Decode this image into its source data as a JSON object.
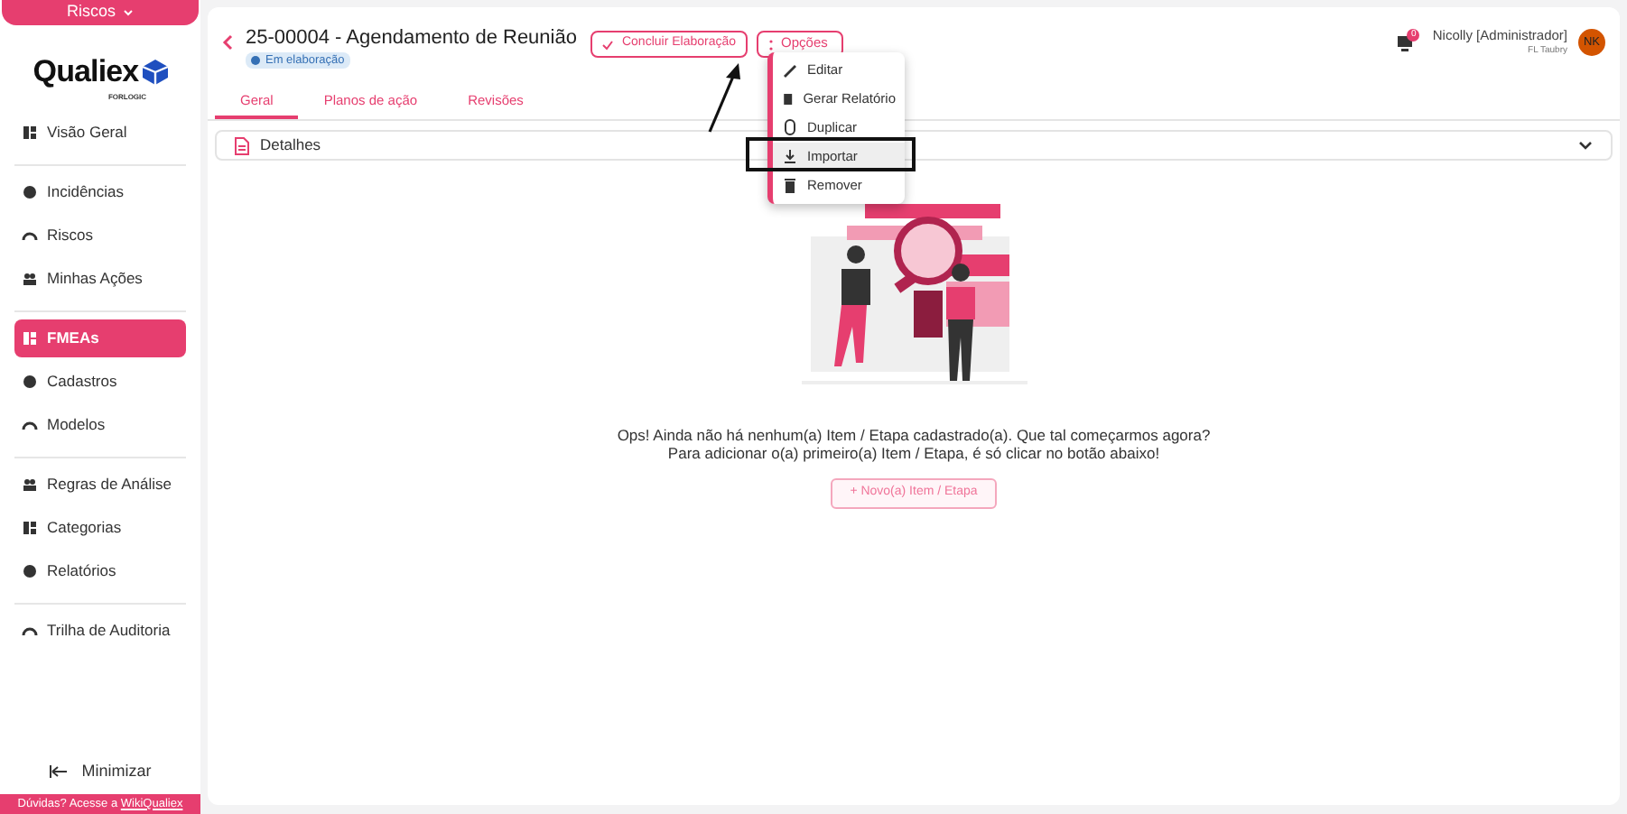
{
  "module_button": {
    "label": "Riscos"
  },
  "logo": {
    "name": "Qualiex",
    "tagline": "FORLOGIC"
  },
  "sidebar": {
    "groups": [
      [
        {
          "label": "Visão Geral",
          "selected": false
        }
      ],
      [
        {
          "label": "Incidências",
          "selected": false
        },
        {
          "label": "Riscos",
          "selected": false
        },
        {
          "label": "Minhas Ações",
          "selected": false
        }
      ],
      [
        {
          "label": "FMEAs",
          "selected": true
        },
        {
          "label": "Cadastros",
          "selected": false
        },
        {
          "label": "Modelos",
          "selected": false
        }
      ],
      [
        {
          "label": "Regras de Análise",
          "selected": false
        },
        {
          "label": "Categorias",
          "selected": false
        },
        {
          "label": "Relatórios",
          "selected": false
        }
      ],
      [
        {
          "label": "Trilha de Auditoria",
          "selected": false
        }
      ]
    ],
    "minimize": "Minimizar",
    "help": {
      "text": "Dúvidas? Acesse a ",
      "link": "WikiQualiex"
    }
  },
  "header": {
    "title": "25-00004 - Agendamento de Reunião",
    "status": "Em elaboração",
    "conclude_button": "Concluir Elaboração",
    "options_button": "Opções"
  },
  "user": {
    "name": "Nicolly [Administrador]",
    "company": "FL Taubry",
    "initials": "NK",
    "notifications": "0"
  },
  "tabs": [
    {
      "label": "Geral",
      "selected": true
    },
    {
      "label": "Planos de ação",
      "selected": false
    },
    {
      "label": "Revisões",
      "selected": false
    }
  ],
  "details": {
    "label": "Detalhes",
    "expanded": false
  },
  "options_menu": [
    {
      "label": "Editar",
      "highlighted": false
    },
    {
      "label": "Gerar Relatório",
      "highlighted": false
    },
    {
      "label": "Duplicar",
      "highlighted": false
    },
    {
      "label": "Importar",
      "highlighted": true
    },
    {
      "label": "Remover",
      "highlighted": false
    }
  ],
  "empty_state": {
    "line_1": "Ops! Ainda não há nenhum(a) Item / Etapa cadastrado(a). Que tal começarmos agora?",
    "line_2": "Para adicionar o(a) primeiro(a) Item / Etapa, é só clicar no botão abaixo!",
    "button": "+ Novo(a) Item / Etapa"
  }
}
